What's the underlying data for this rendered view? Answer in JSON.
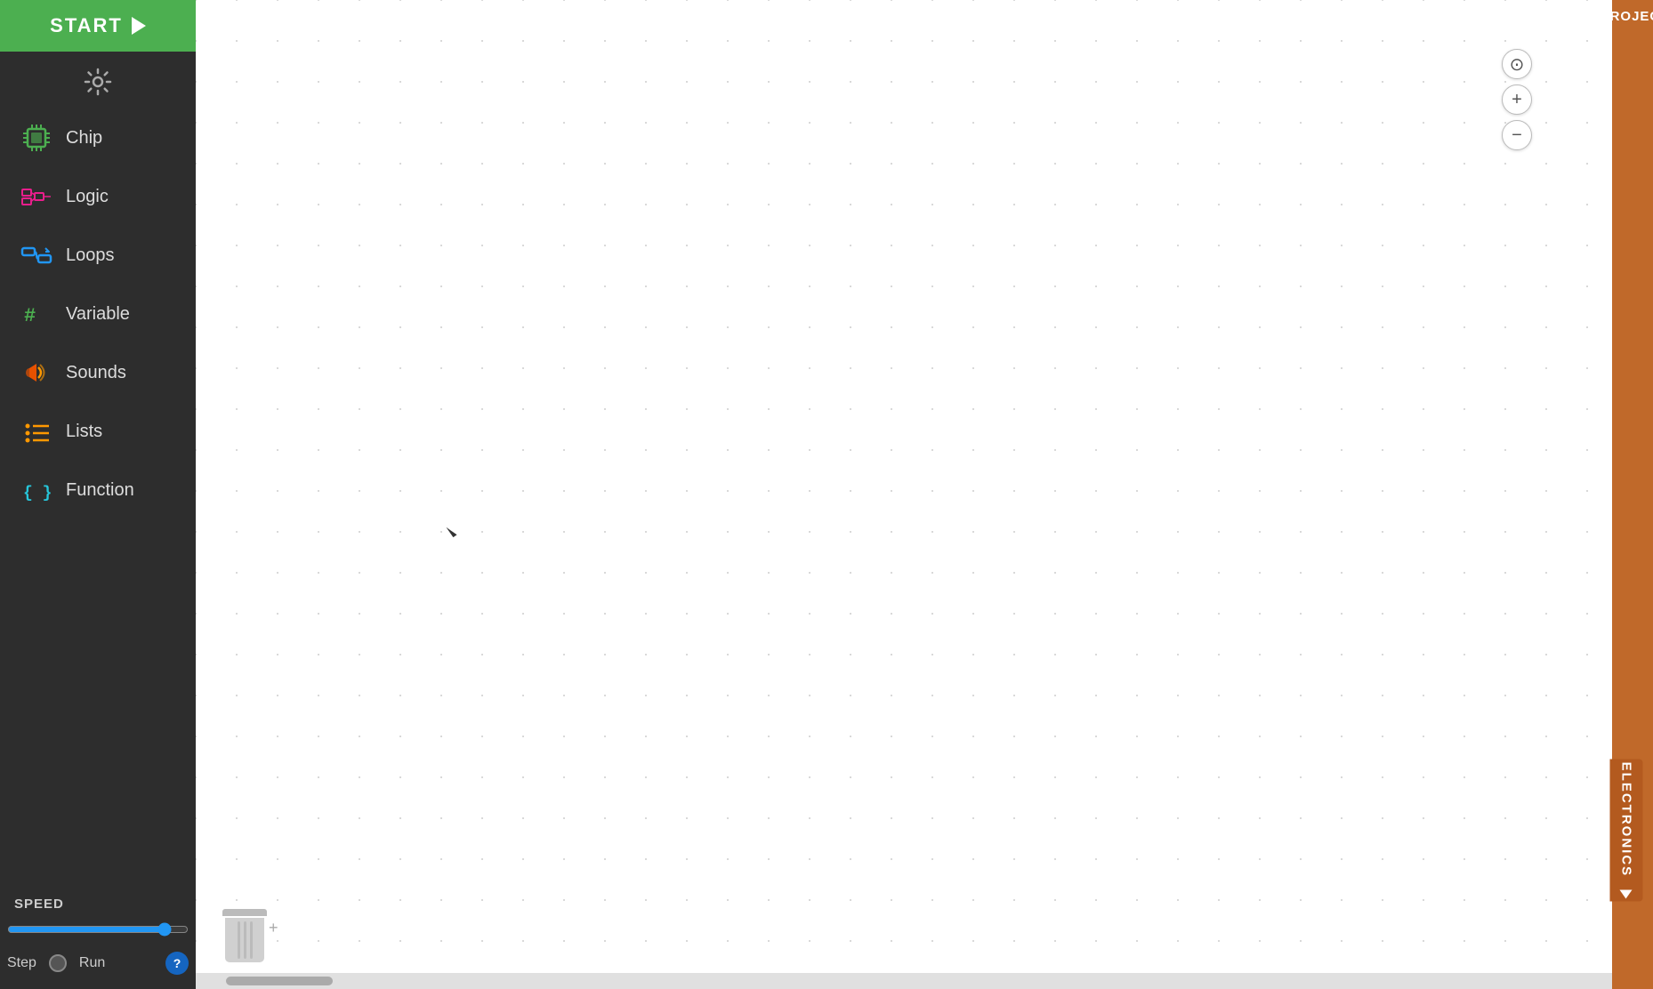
{
  "sidebar": {
    "start_label": "START",
    "settings_label": "Settings",
    "nav_items": [
      {
        "id": "chip",
        "label": "Chip",
        "icon": "chip-icon"
      },
      {
        "id": "logic",
        "label": "Logic",
        "icon": "logic-icon"
      },
      {
        "id": "loops",
        "label": "Loops",
        "icon": "loops-icon"
      },
      {
        "id": "variable",
        "label": "Variable",
        "icon": "variable-icon"
      },
      {
        "id": "sounds",
        "label": "Sounds",
        "icon": "sounds-icon"
      },
      {
        "id": "lists",
        "label": "Lists",
        "icon": "lists-icon"
      },
      {
        "id": "function",
        "label": "Function",
        "icon": "function-icon"
      }
    ],
    "speed_label": "SPEED",
    "step_label": "Step",
    "run_label": "Run",
    "help_label": "?"
  },
  "toolbar": {
    "projects_label": "PROJECTS",
    "electronics_label": "ELECTRONICS"
  },
  "zoom": {
    "locate_label": "⊙",
    "zoom_in_label": "+",
    "zoom_out_label": "−"
  },
  "canvas": {
    "background": "#ffffff"
  }
}
